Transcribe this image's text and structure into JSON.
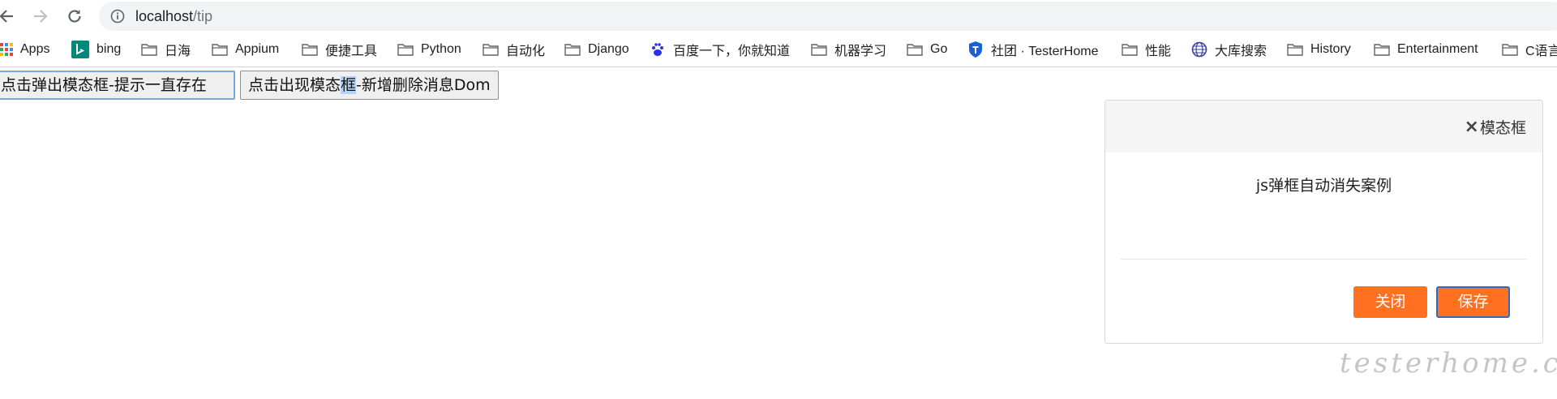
{
  "browser": {
    "url_host": "localhost",
    "url_path": "/tip"
  },
  "bookmarks": [
    {
      "label": "Apps",
      "icon": "apps-grid-icon"
    },
    {
      "label": "bing",
      "icon": "bing-icon"
    },
    {
      "label": "日海",
      "icon": "folder-icon"
    },
    {
      "label": "Appium",
      "icon": "folder-icon"
    },
    {
      "label": "便捷工具",
      "icon": "folder-icon"
    },
    {
      "label": "Python",
      "icon": "folder-icon"
    },
    {
      "label": "自动化",
      "icon": "folder-icon"
    },
    {
      "label": "Django",
      "icon": "folder-icon"
    },
    {
      "label": "百度一下，你就知道",
      "icon": "baidu-paw-icon"
    },
    {
      "label": "机器学习",
      "icon": "folder-icon"
    },
    {
      "label": "Go",
      "icon": "folder-icon"
    },
    {
      "label": "社团 · TesterHome",
      "icon": "testerhome-shield-icon"
    },
    {
      "label": "性能",
      "icon": "folder-icon"
    },
    {
      "label": "大库搜索",
      "icon": "globe-icon"
    },
    {
      "label": "History",
      "icon": "folder-icon"
    },
    {
      "label": "Entertainment",
      "icon": "folder-icon"
    },
    {
      "label": "C语言",
      "icon": "folder-icon"
    }
  ],
  "page": {
    "button1_label": "点击弹出模态框-提示一直存在",
    "button2_before": "点击出现模态",
    "button2_selected": "框",
    "button2_after": "-新增删除消息Dom"
  },
  "modal": {
    "title": "模态框",
    "message": "js弹框自动消失案例",
    "close_label": "关闭",
    "save_label": "保存",
    "accent_color": "#ff7021"
  },
  "watermark": "testerhome.com"
}
